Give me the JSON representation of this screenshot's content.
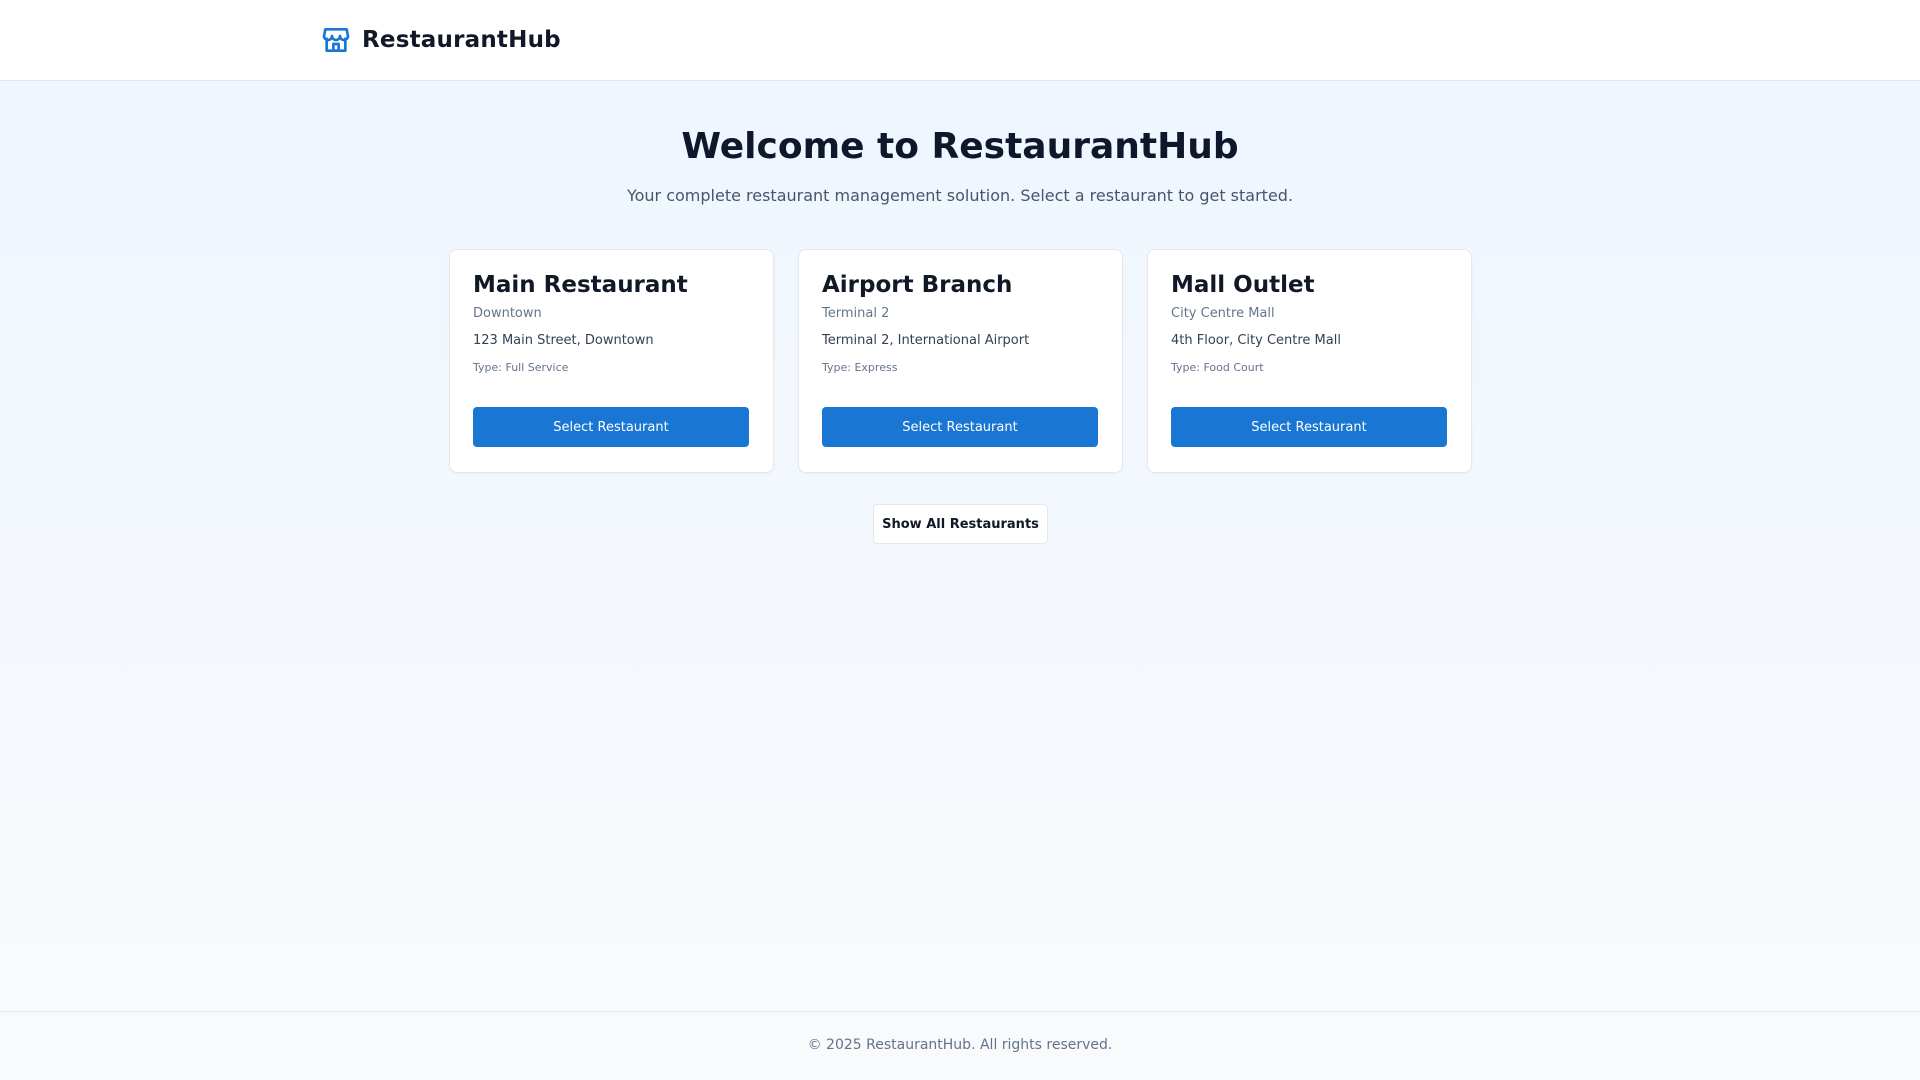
{
  "app": {
    "name": "RestaurantHub",
    "logo_icon": "store-icon",
    "accent": "#1976d2"
  },
  "hero": {
    "title": "Welcome to RestaurantHub",
    "subtitle": "Your complete restaurant management solution. Select a restaurant to get started."
  },
  "restaurants": [
    {
      "name": "Main Restaurant",
      "area": "Downtown",
      "address": "123 Main Street, Downtown",
      "type": "Type: Full Service",
      "button_label": "Select Restaurant"
    },
    {
      "name": "Airport Branch",
      "area": "Terminal 2",
      "address": "Terminal 2, International Airport",
      "type": "Type: Express",
      "button_label": "Select Restaurant"
    },
    {
      "name": "Mall Outlet",
      "area": "City Centre Mall",
      "address": "4th Floor, City Centre Mall",
      "type": "Type: Food Court",
      "button_label": "Select Restaurant"
    }
  ],
  "show_all_label": "Show All Restaurants",
  "footer": {
    "copyright": "© 2025 RestaurantHub. All rights reserved."
  }
}
